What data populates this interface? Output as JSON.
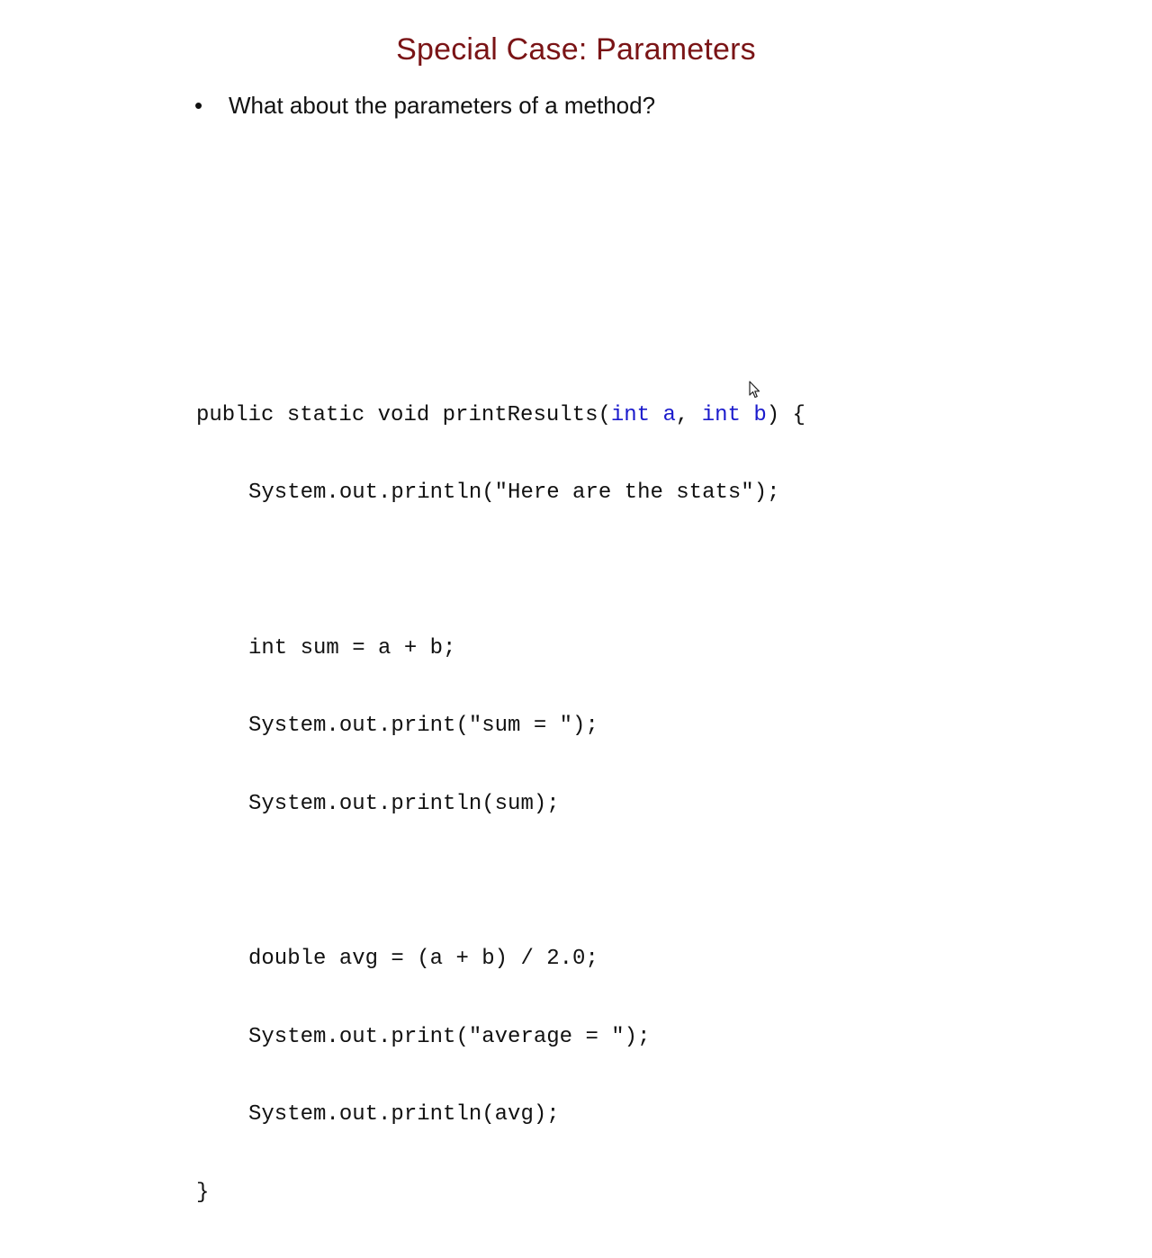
{
  "slide": {
    "title": "Special Case: Parameters",
    "bullet": {
      "marker": "•",
      "text": "What about the parameters of a method?"
    }
  },
  "code": {
    "sig_prefix": "public static void printResults(",
    "param_type_1": "int a",
    "sep": ", ",
    "param_type_2": "int b",
    "sig_suffix": ") {",
    "line_println_header": "System.out.println(\"Here are the stats\");",
    "line_sum_decl": "int sum = a + b;",
    "line_print_sum_label": "System.out.print(\"sum = \");",
    "line_println_sum": "System.out.println(sum);",
    "line_avg_decl": "double avg = (a + b) / 2.0;",
    "line_print_avg_label": "System.out.print(\"average = \");",
    "line_println_avg": "System.out.println(avg);",
    "closing_brace": "}"
  },
  "colors": {
    "title": "#7a1416",
    "param_highlight": "#1a1acc",
    "text": "#111111"
  },
  "icons": {
    "cursor": "mouse-pointer-icon"
  }
}
